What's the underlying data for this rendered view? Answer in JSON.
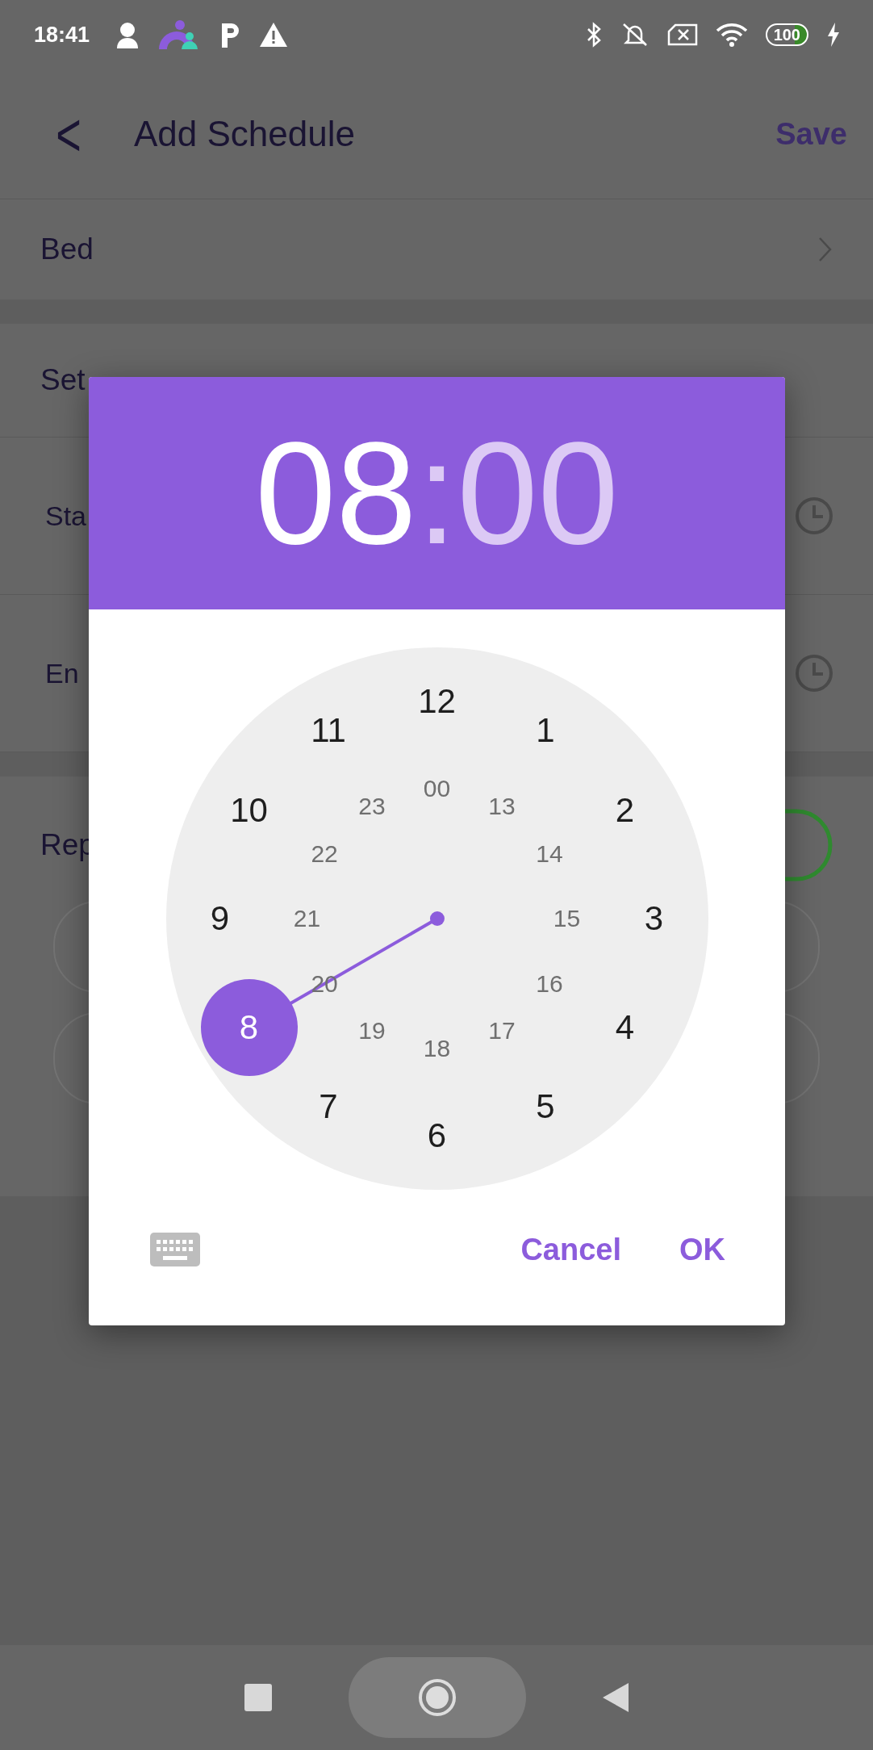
{
  "status_bar": {
    "time": "18:41",
    "battery": "100"
  },
  "header": {
    "back": "<",
    "title": "Add Schedule",
    "action": "Save"
  },
  "rows": [
    {
      "kind": "nav",
      "label": "Bed"
    }
  ],
  "period": {
    "label": "Set",
    "start_label": "Sta",
    "end_label": "En"
  },
  "repeat": {
    "label": "Rep",
    "on": true
  },
  "dialog": {
    "hour": "08",
    "separator": ":",
    "minute": "00",
    "outer": [
      {
        "label": "12",
        "selected": false
      },
      {
        "label": "1",
        "selected": false
      },
      {
        "label": "2",
        "selected": false
      },
      {
        "label": "3",
        "selected": false
      },
      {
        "label": "4",
        "selected": false
      },
      {
        "label": "5",
        "selected": false
      },
      {
        "label": "6",
        "selected": false
      },
      {
        "label": "7",
        "selected": false
      },
      {
        "label": "8",
        "selected": true
      },
      {
        "label": "9",
        "selected": false
      },
      {
        "label": "10",
        "selected": false
      },
      {
        "label": "11",
        "selected": false
      }
    ],
    "inner": [
      {
        "label": "00",
        "selected": false
      },
      {
        "label": "13",
        "selected": false
      },
      {
        "label": "14",
        "selected": false
      },
      {
        "label": "15",
        "selected": false
      },
      {
        "label": "16",
        "selected": false
      },
      {
        "label": "17",
        "selected": false
      },
      {
        "label": "18",
        "selected": false
      },
      {
        "label": "19",
        "selected": false
      },
      {
        "label": "20",
        "selected": false
      },
      {
        "label": "21",
        "selected": false
      },
      {
        "label": "22",
        "selected": false
      },
      {
        "label": "23",
        "selected": false
      }
    ],
    "buttons": [
      "Cancel",
      "OK"
    ]
  }
}
